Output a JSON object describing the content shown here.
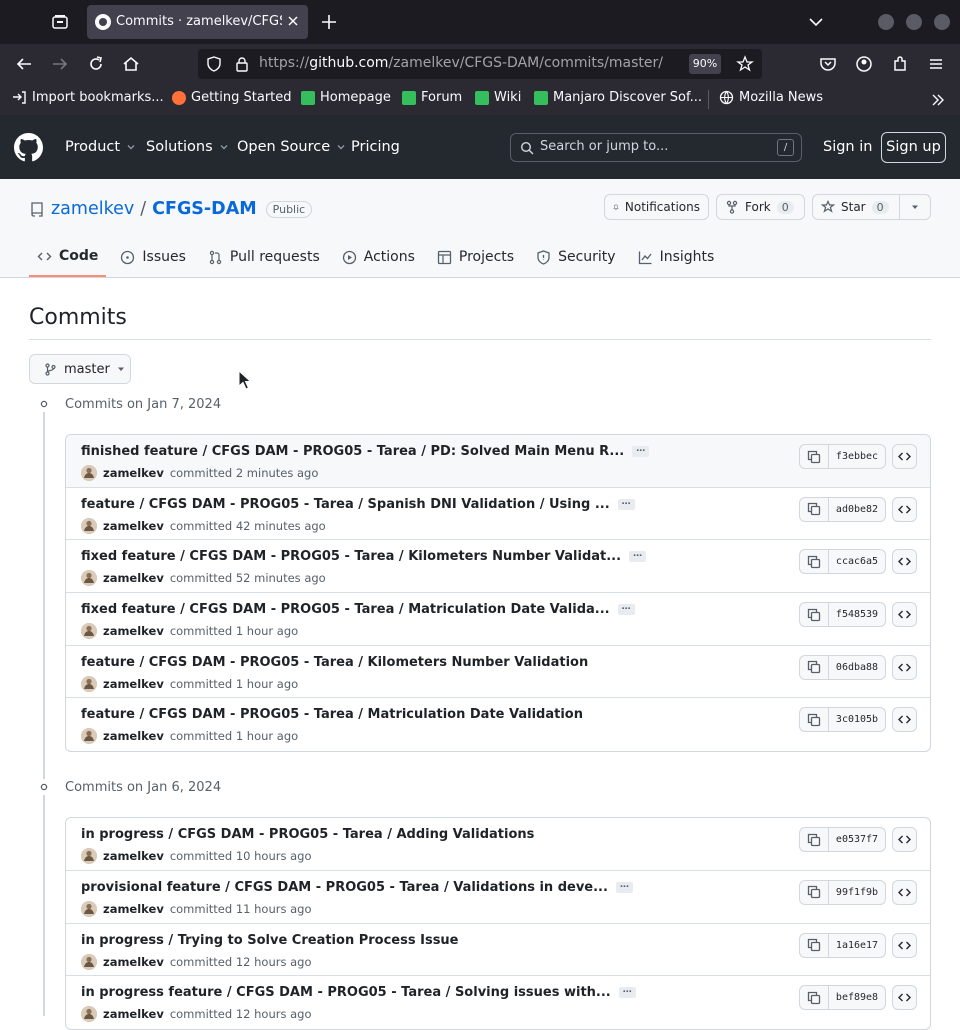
{
  "browser": {
    "tab_title": "Commits · zamelkev/CFGS-DAM",
    "url_prefix": "https://",
    "url_host": "github.com",
    "url_path": "/zamelkev/CFGS-DAM/commits/master/",
    "zoom": "90%",
    "bookmarks": [
      "Import bookmarks...",
      "Getting Started",
      "Homepage",
      "Forum",
      "Wiki",
      "Manjaro Discover Sof...",
      "Mozilla News"
    ]
  },
  "gh_nav": {
    "product": "Product",
    "solutions": "Solutions",
    "open_source": "Open Source",
    "pricing": "Pricing",
    "search_placeholder": "Search or jump to...",
    "search_key": "/",
    "sign_in": "Sign in",
    "sign_up": "Sign up"
  },
  "repo": {
    "owner": "zamelkev",
    "sep": "/",
    "name": "CFGS-DAM",
    "visibility": "Public",
    "notifications": "Notifications",
    "fork_label": "Fork",
    "fork_count": "0",
    "star_label": "Star",
    "star_count": "0",
    "tabs": [
      "Code",
      "Issues",
      "Pull requests",
      "Actions",
      "Projects",
      "Security",
      "Insights"
    ]
  },
  "commits_page": {
    "title": "Commits",
    "branch": "master",
    "groups": [
      {
        "date": "Commits on Jan 7, 2024",
        "commits": [
          {
            "message": "finished feature / CFGS DAM - PROG05 - Tarea / PD: Solved Main Menu R...",
            "has_more": true,
            "author": "zamelkev",
            "when": "committed 2 minutes ago",
            "sha": "f3ebbec"
          },
          {
            "message": "feature / CFGS DAM - PROG05 - Tarea / Spanish DNI Validation / Using ...",
            "has_more": true,
            "author": "zamelkev",
            "when": "committed 42 minutes ago",
            "sha": "ad0be82"
          },
          {
            "message": "fixed feature / CFGS DAM - PROG05 - Tarea / Kilometers Number Validat...",
            "has_more": true,
            "author": "zamelkev",
            "when": "committed 52 minutes ago",
            "sha": "ccac6a5"
          },
          {
            "message": "fixed feature / CFGS DAM - PROG05 - Tarea / Matriculation Date Valida...",
            "has_more": true,
            "author": "zamelkev",
            "when": "committed 1 hour ago",
            "sha": "f548539"
          },
          {
            "message": "feature / CFGS DAM - PROG05 - Tarea / Kilometers Number Validation",
            "has_more": false,
            "author": "zamelkev",
            "when": "committed 1 hour ago",
            "sha": "06dba88"
          },
          {
            "message": "feature / CFGS DAM - PROG05 - Tarea / Matriculation Date Validation",
            "has_more": false,
            "author": "zamelkev",
            "when": "committed 1 hour ago",
            "sha": "3c0105b"
          }
        ]
      },
      {
        "date": "Commits on Jan 6, 2024",
        "commits": [
          {
            "message": "in progress / CFGS DAM - PROG05 - Tarea / Adding Validations",
            "has_more": false,
            "author": "zamelkev",
            "when": "committed 10 hours ago",
            "sha": "e0537f7"
          },
          {
            "message": "provisional feature / CFGS DAM - PROG05 - Tarea / Validations in deve...",
            "has_more": true,
            "author": "zamelkev",
            "when": "committed 11 hours ago",
            "sha": "99f1f9b"
          },
          {
            "message": "in progress / Trying to Solve Creation Process Issue",
            "has_more": false,
            "author": "zamelkev",
            "when": "committed 12 hours ago",
            "sha": "1a16e17"
          },
          {
            "message": "in progress feature / CFGS DAM - PROG05 - Tarea / Solving issues with...",
            "has_more": true,
            "author": "zamelkev",
            "when": "committed 12 hours ago",
            "sha": "bef89e8"
          }
        ]
      }
    ]
  },
  "colors": {
    "link": "#0969da",
    "header_bg": "#24292f",
    "browser_bg": "#1c1b22",
    "tab_underline": "#fd8c73"
  }
}
